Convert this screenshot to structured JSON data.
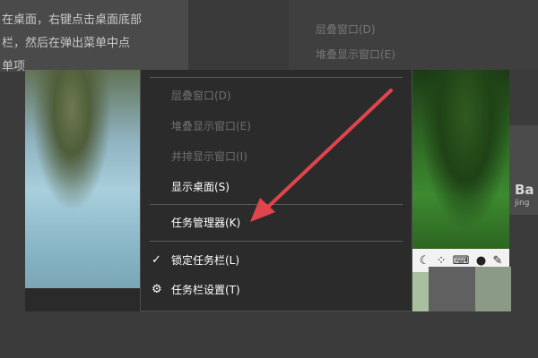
{
  "article": {
    "line1": "在桌面，右键点击桌面底部",
    "line2": "栏，然后在弹出菜单中点",
    "line3": "单项"
  },
  "background_menu": {
    "item1": "层叠窗口(D)",
    "item2": "堆叠显示窗口(E)"
  },
  "context_menu": {
    "items": [
      {
        "label": "层叠窗口(D)",
        "enabled": false
      },
      {
        "label": "堆叠显示窗口(E)",
        "enabled": false
      },
      {
        "label": "并排显示窗口(I)",
        "enabled": false
      },
      {
        "label": "显示桌面(S)",
        "enabled": true
      },
      {
        "label": "任务管理器(K)",
        "enabled": true
      },
      {
        "label": "锁定任务栏(L)",
        "enabled": true,
        "checked": true,
        "icon": "checkmark-icon"
      },
      {
        "label": "任务栏设置(T)",
        "enabled": true,
        "icon": "gear-icon"
      }
    ]
  },
  "tray_icons": [
    "moon-icon",
    "network-icon",
    "keyboard-icon",
    "person-icon",
    "wrench-icon"
  ],
  "watermark": {
    "text": "Ba",
    "sub": "jing"
  },
  "colors": {
    "menu_bg": "#2b2b2b",
    "menu_text": "#ffffff",
    "menu_disabled": "#6f6f6f",
    "arrow": "#e0444c"
  }
}
